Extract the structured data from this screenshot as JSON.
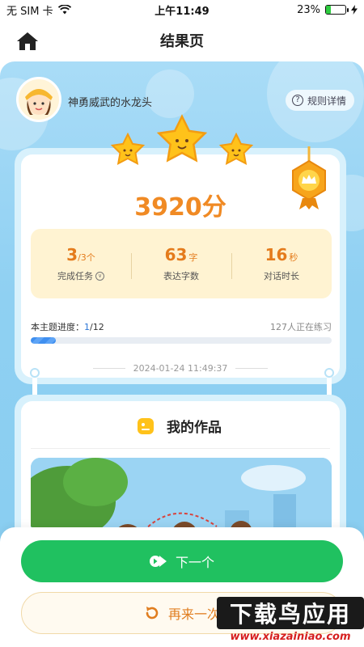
{
  "status_bar": {
    "carrier": "无 SIM 卡",
    "time": "上午11:49",
    "battery_percent": "23%",
    "battery_level": 0.23
  },
  "nav": {
    "title": "结果页"
  },
  "user": {
    "name": "神勇威武的水龙头",
    "rules_label": "规则详情"
  },
  "result": {
    "stars": 3,
    "score": "3920分",
    "stats": [
      {
        "value": "3",
        "sub": "/3个",
        "unit": "",
        "label": "完成任务"
      },
      {
        "value": "63",
        "sub": "",
        "unit": "字",
        "label": "表达字数"
      },
      {
        "value": "16",
        "sub": "",
        "unit": "秒",
        "label": "对话时长"
      }
    ],
    "progress_label": "本主题进度：",
    "progress_current": "1",
    "progress_total": "/12",
    "progress_fraction": 0.083,
    "practicing_count": "127人正在练习",
    "timestamp": "2024-01-24 11:49:37"
  },
  "works": {
    "title": "我的作品"
  },
  "actions": {
    "next_label": "下一个",
    "retry_label": "再来一次"
  },
  "watermark": {
    "main": "下载鸟应用",
    "url": "www.xiazainiao.com"
  },
  "colors": {
    "score": "#f08a24",
    "next_button": "#20c160",
    "progress": "#3f8ff0",
    "background": "#8fd0f2"
  }
}
